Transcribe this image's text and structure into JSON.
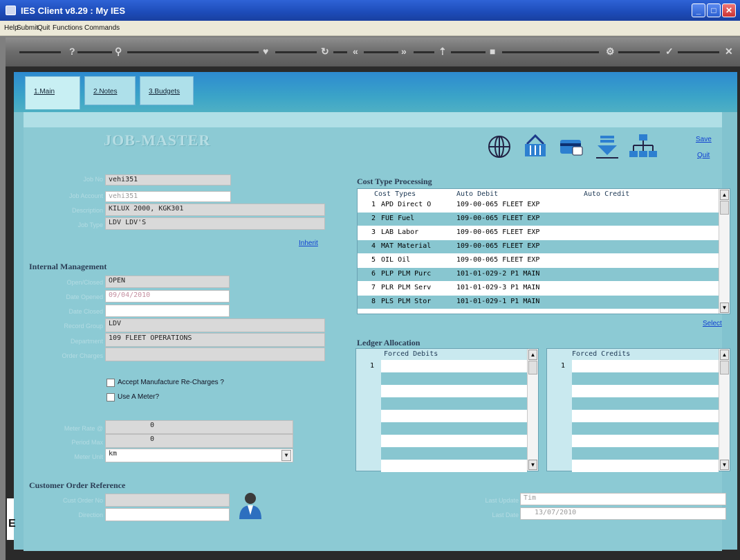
{
  "window": {
    "title": "IES Client v8.29 : My IES",
    "minimize": "_",
    "maximize": "□",
    "close": "✕"
  },
  "menu": [
    "Help",
    "Submit",
    "Quit",
    "Functions",
    "Commands"
  ],
  "tabs": [
    "1.Main",
    "2.Notes",
    "3.Budgets"
  ],
  "page_title": "JOB-MASTER",
  "links": {
    "save": "Save",
    "quit": "Quit",
    "inherit": "Inherit",
    "select": "Select"
  },
  "job": {
    "job_no_label": "Job No",
    "job_no": "vehi351",
    "job_account_label": "Job Account",
    "job_account": "vehi351",
    "description_label": "Description",
    "description": "KILUX 2000, KGK301",
    "job_type_label": "Job Type",
    "job_type": "LDV LDV'S"
  },
  "internal": {
    "heading": "Internal Management",
    "open_closed_label": "Open/Closed",
    "open_closed": "OPEN",
    "date_opened_label": "Date Opened",
    "date_opened": "09/04/2010",
    "date_closed_label": "Date Closed",
    "date_closed": "",
    "record_group_label": "Record Group",
    "record_group": "LDV",
    "department_label": "Department",
    "department": "109 FLEET OPERATIONS",
    "order_charges_label": "Order Charges",
    "order_charges": "",
    "accept_recharges": "Accept Manufacture Re-Charges ?",
    "use_meter": "Use A Meter?",
    "meter_rate_label": "Meter Rate @",
    "meter_rate": "0",
    "period_max_label": "Period Max",
    "period_max": "0",
    "meter_unit_label": "Meter Unit",
    "meter_unit": "km"
  },
  "customer": {
    "heading": "Customer Order Reference",
    "order_no_label": "Cust Order No",
    "order_no": "",
    "direction_label": "Direction",
    "direction": ""
  },
  "cost_types": {
    "heading": "Cost Type Processing",
    "columns": [
      "Cost Types",
      "Auto Debit",
      "Auto Credit"
    ],
    "rows": [
      {
        "n": "1",
        "type": "APD Direct O",
        "debit": "109-00-065 FLEET EXP"
      },
      {
        "n": "2",
        "type": "FUE Fuel",
        "debit": "109-00-065 FLEET EXP"
      },
      {
        "n": "3",
        "type": "LAB Labor",
        "debit": "109-00-065 FLEET EXP"
      },
      {
        "n": "4",
        "type": "MAT Material",
        "debit": "109-00-065 FLEET EXP"
      },
      {
        "n": "5",
        "type": "OIL Oil",
        "debit": "109-00-065 FLEET EXP"
      },
      {
        "n": "6",
        "type": "PLP PLM Purc",
        "debit": "101-01-029-2 P1 MAIN"
      },
      {
        "n": "7",
        "type": "PLR PLM Serv",
        "debit": "101-01-029-3 P1 MAIN"
      },
      {
        "n": "8",
        "type": "PLS PLM Stor",
        "debit": "101-01-029-1 P1 MAIN"
      }
    ]
  },
  "ledger": {
    "heading": "Ledger Allocation",
    "debits_title": "Forced Debits",
    "credits_title": "Forced Credits",
    "row_number": "1"
  },
  "audit": {
    "last_update_label": "Last Update",
    "last_update": "Tim",
    "last_date_label": "Last Date",
    "last_date": "13/07/2010"
  },
  "colors": {
    "panel": "#8ccad4",
    "title_bar": "#1d4bb8",
    "tab_band": "#2d8ad0"
  }
}
